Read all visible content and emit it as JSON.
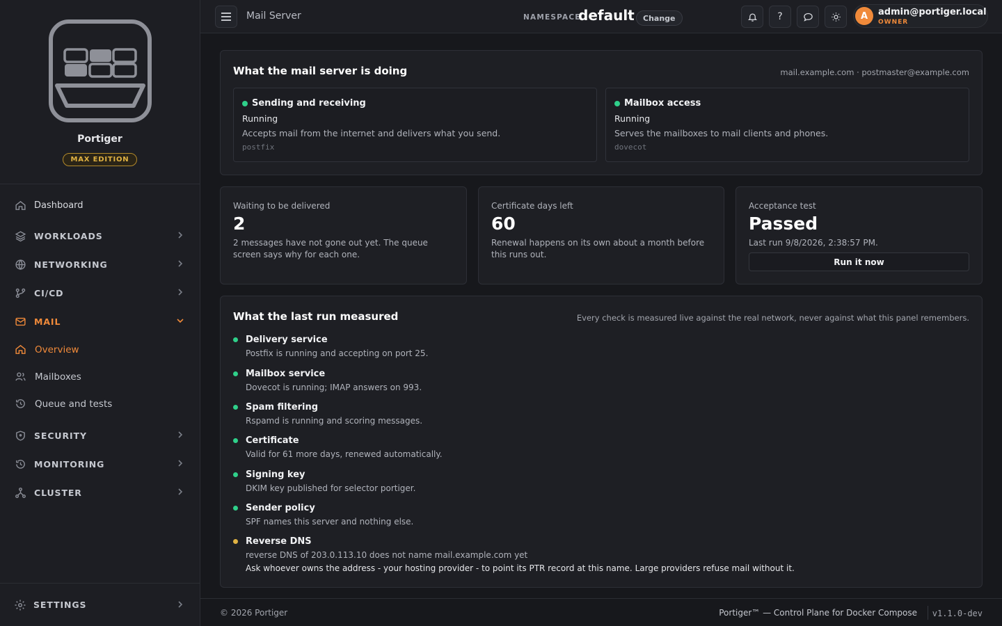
{
  "brand": {
    "name": "Portiger",
    "edition": "MAX EDITION"
  },
  "nav": {
    "dashboard": "Dashboard",
    "workloads": "WORKLOADS",
    "networking": "NETWORKING",
    "cicd": "CI/CD",
    "mail": "MAIL",
    "mail_items": [
      "Overview",
      "Mailboxes",
      "Queue and tests"
    ],
    "security": "SECURITY",
    "monitoring": "MONITORING",
    "cluster": "CLUSTER",
    "settings": "SETTINGS"
  },
  "topbar": {
    "page": "Mail Server",
    "namespace_label": "NAMESPACE",
    "namespace": "default",
    "change": "Change",
    "user": "admin@portiger.local",
    "role": "OWNER",
    "avatar_letter": "A"
  },
  "doing": {
    "title": "What the mail server is doing",
    "host": "mail.example.com · postmaster@example.com",
    "cards": [
      {
        "title": "Sending and receiving",
        "state": "Running",
        "desc": "Accepts mail from the internet and delivers what you send.",
        "tech": "postfix"
      },
      {
        "title": "Mailbox access",
        "state": "Running",
        "desc": "Serves the mailboxes to mail clients and phones.",
        "tech": "dovecot"
      }
    ]
  },
  "stats": {
    "queue": {
      "label": "Waiting to be delivered",
      "value": "2",
      "desc": "2 messages have not gone out yet. The queue screen says why for each one."
    },
    "cert": {
      "label": "Certificate days left",
      "value": "60",
      "desc": "Renewal happens on its own about a month before this runs out."
    },
    "test": {
      "label": "Acceptance test",
      "value": "Passed",
      "desc": "Last run 9/8/2026, 2:38:57 PM.",
      "button": "Run it now"
    }
  },
  "measured": {
    "title": "What the last run measured",
    "note": "Every check is measured live against the real network, never against what this panel remembers.",
    "checks": [
      {
        "title": "Delivery service",
        "detail": "Postfix is running and accepting on port 25.",
        "status": "ok"
      },
      {
        "title": "Mailbox service",
        "detail": "Dovecot is running; IMAP answers on 993.",
        "status": "ok"
      },
      {
        "title": "Spam filtering",
        "detail": "Rspamd is running and scoring messages.",
        "status": "ok"
      },
      {
        "title": "Certificate",
        "detail": "Valid for 61 more days, renewed automatically.",
        "status": "ok"
      },
      {
        "title": "Signing key",
        "detail": "DKIM key published for selector portiger.",
        "status": "ok"
      },
      {
        "title": "Sender policy",
        "detail": "SPF names this server and nothing else.",
        "status": "ok"
      },
      {
        "title": "Reverse DNS",
        "detail": "reverse DNS of 203.0.113.10 does not name mail.example.com yet",
        "advice": "Ask whoever owns the address - your hosting provider - to point its PTR record at this name. Large providers refuse mail without it.",
        "status": "warn"
      }
    ]
  },
  "footer": {
    "copyright": "© 2026 Portiger",
    "tagline": "Portiger™ — Control Plane for Docker Compose",
    "version": "v1.1.0-dev"
  },
  "colors": {
    "accent": "#f08a3a",
    "ok": "#2fd08a",
    "warn": "#e0b243"
  }
}
